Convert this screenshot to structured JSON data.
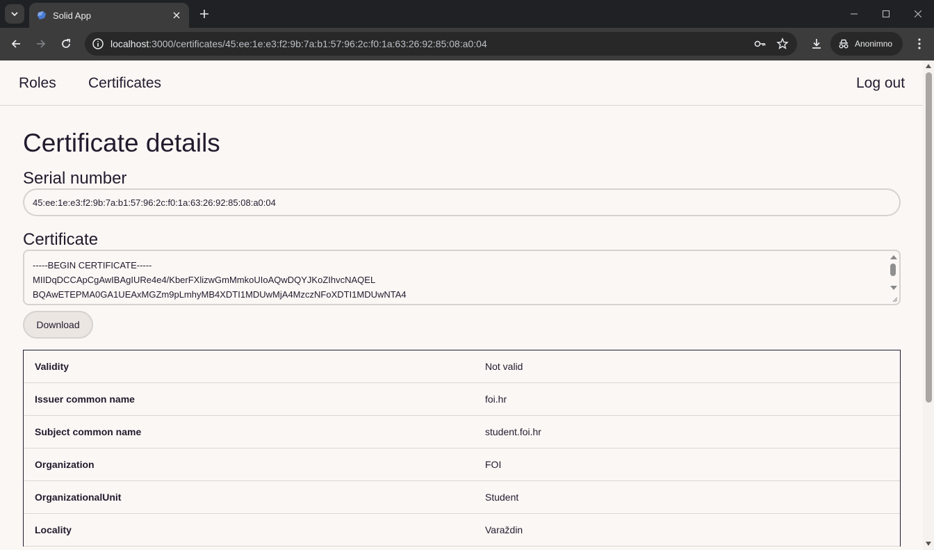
{
  "browser": {
    "tab_title": "Solid App",
    "url_host": "localhost",
    "url_path": ":3000/certificates/45:ee:1e:e3:f2:9b:7a:b1:57:96:2c:f0:1a:63:26:92:85:08:a0:04",
    "profile_label": "Anonimno",
    "icons": [
      "chevron-down-icon",
      "close-icon",
      "plus-icon",
      "back-arrow-icon",
      "forward-arrow-icon",
      "reload-icon",
      "info-icon",
      "key-icon",
      "star-icon",
      "download-icon",
      "incognito-icon",
      "kebab-menu-icon",
      "minimize-icon",
      "maximize-icon",
      "window-close-icon"
    ]
  },
  "nav": {
    "roles": "Roles",
    "certificates": "Certificates",
    "logout": "Log out"
  },
  "page": {
    "title": "Certificate details",
    "serial_label": "Serial number",
    "serial_value": "45:ee:1e:e3:f2:9b:7a:b1:57:96:2c:f0:1a:63:26:92:85:08:a0:04",
    "certificate_label": "Certificate",
    "certificate_lines": [
      "-----BEGIN CERTIFICATE-----",
      "MIIDqDCCApCgAwIBAgIURe4e4/KberFXlizwGmMmkoUIoAQwDQYJKoZIhvcNAQEL",
      "BQAwETEPMA0GA1UEAxMGZm9pLmhyMB4XDTI1MDUwMjA4MzczNFoXDTI1MDUwNTA4"
    ],
    "download_label": "Download"
  },
  "details": [
    {
      "key": "Validity",
      "value": "Not valid"
    },
    {
      "key": "Issuer common name",
      "value": "foi.hr"
    },
    {
      "key": "Subject common name",
      "value": "student.foi.hr"
    },
    {
      "key": "Organization",
      "value": "FOI"
    },
    {
      "key": "OrganizationalUnit",
      "value": "Student"
    },
    {
      "key": "Locality",
      "value": "Varaždin"
    }
  ],
  "colors": {
    "page_bg": "#faf7f4",
    "text": "#231a2e",
    "border": "#d6d2d0",
    "chrome_bg": "#3c3c3c"
  }
}
